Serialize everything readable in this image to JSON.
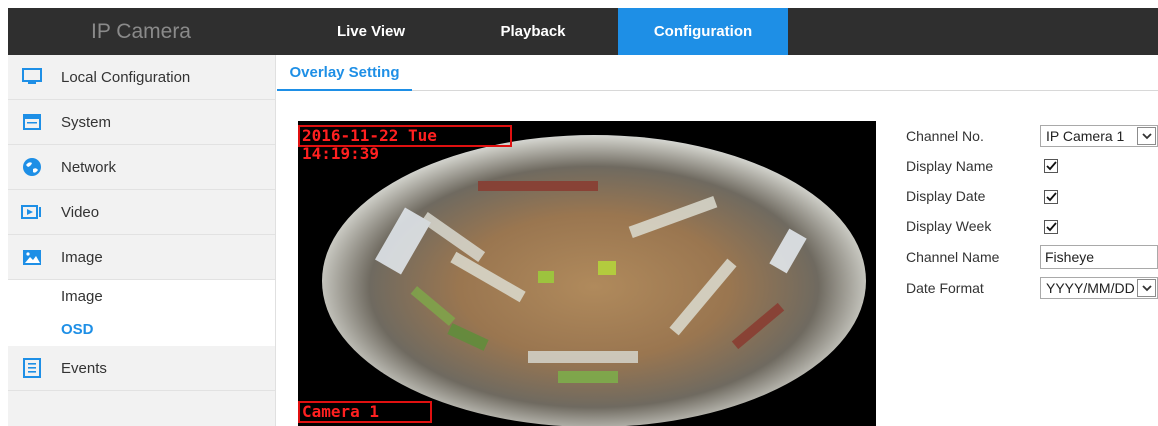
{
  "header": {
    "brand": "IP Camera",
    "tabs": [
      {
        "label": "Live View",
        "active": false
      },
      {
        "label": "Playback",
        "active": false
      },
      {
        "label": "Configuration",
        "active": true
      }
    ],
    "accent_color": "#1e8fe6"
  },
  "sidebar": {
    "items": [
      {
        "label": "Local Configuration",
        "icon": "monitor-icon"
      },
      {
        "label": "System",
        "icon": "system-window-icon"
      },
      {
        "label": "Network",
        "icon": "globe-icon"
      },
      {
        "label": "Video",
        "icon": "video-camera-icon"
      },
      {
        "label": "Image",
        "icon": "image-icon"
      }
    ],
    "sub_items": [
      {
        "label": "Image",
        "active": false
      },
      {
        "label": "OSD",
        "active": true
      }
    ],
    "events": {
      "label": "Events",
      "icon": "events-list-icon"
    }
  },
  "content": {
    "tab": "Overlay Setting",
    "video": {
      "osd_date": "2016-11-22 Tue 14:19:39",
      "osd_name": "Camera 1"
    },
    "form": {
      "channel_no_label": "Channel No.",
      "channel_no_value": "IP Camera 1",
      "display_name_label": "Display Name",
      "display_name_checked": true,
      "display_date_label": "Display Date",
      "display_date_checked": true,
      "display_week_label": "Display Week",
      "display_week_checked": true,
      "channel_name_label": "Channel Name",
      "channel_name_value": "Fisheye",
      "date_format_label": "Date Format",
      "date_format_value": "YYYY/MM/DD"
    }
  }
}
